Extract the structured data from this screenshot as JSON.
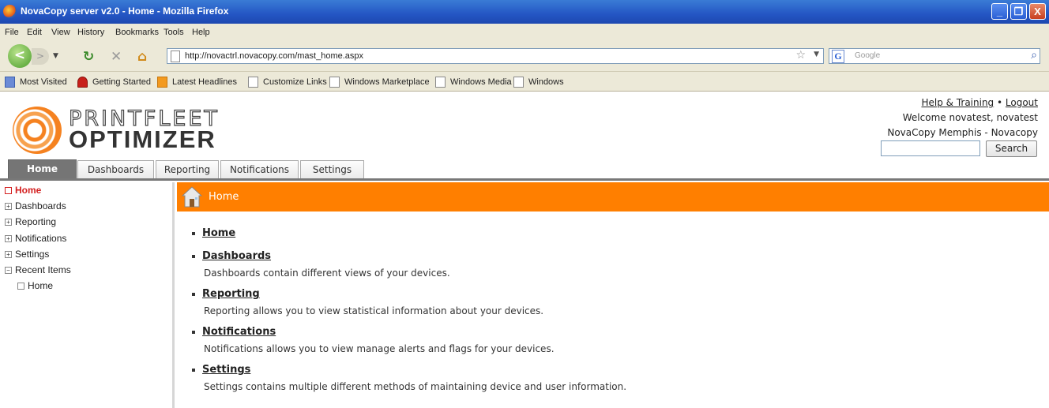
{
  "window": {
    "title": "NovaCopy server v2.0 - Home - Mozilla Firefox",
    "minimize": "_",
    "maximize": "❐",
    "close": "X"
  },
  "menu": [
    "File",
    "Edit",
    "View",
    "History",
    "Bookmarks",
    "Tools",
    "Help"
  ],
  "nav": {
    "back": "<",
    "forward": ">",
    "url": "http://novactrl.novacopy.com/mast_home.aspx",
    "search_placeholder": "Google"
  },
  "bookmarks": [
    "Most Visited",
    "Getting Started",
    "Latest Headlines",
    "Customize Links",
    "Windows Marketplace",
    "Windows Media",
    "Windows"
  ],
  "brand": {
    "line1": "PRINTFLEET",
    "line2": "OPTIMIZER"
  },
  "user": {
    "help": "Help & Training",
    "sep": "•",
    "logout": "Logout",
    "welcome": "Welcome novatest, novatest",
    "org": "NovaCopy Memphis - Novacopy",
    "search_button": "Search"
  },
  "tabs": [
    "Home",
    "Dashboards",
    "Reporting",
    "Notifications",
    "Settings"
  ],
  "sidebar": {
    "items": [
      {
        "label": "Home",
        "marker": ""
      },
      {
        "label": "Dashboards",
        "marker": "+"
      },
      {
        "label": "Reporting",
        "marker": "+"
      },
      {
        "label": "Notifications",
        "marker": "+"
      },
      {
        "label": "Settings",
        "marker": "+"
      },
      {
        "label": "Recent Items",
        "marker": "−"
      }
    ],
    "recent": [
      {
        "label": "Home"
      }
    ]
  },
  "main": {
    "title": "Home",
    "items": [
      {
        "title": "Home",
        "desc": ""
      },
      {
        "title": "Dashboards",
        "desc": "Dashboards contain different views of your devices."
      },
      {
        "title": "Reporting",
        "desc": "Reporting allows you to view statistical information about your devices."
      },
      {
        "title": "Notifications",
        "desc": "Notifications allows you to view manage alerts and flags for your devices."
      },
      {
        "title": "Settings",
        "desc": "Settings contains multiple different methods of maintaining device and user information."
      }
    ]
  },
  "colors": {
    "accent": "#ff7f00",
    "tab_active": "#757575",
    "sidebar_active": "#d42020"
  }
}
